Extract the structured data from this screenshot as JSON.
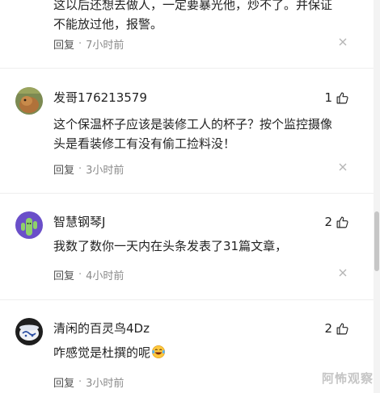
{
  "top_partial": {
    "text_line1": "这以后还想去做人，一定要暴光他，炒不了。并保证",
    "text_line2": "不能放过他，报警。",
    "reply_label": "回复",
    "separator": "·",
    "time": "7小时前"
  },
  "comments": [
    {
      "username": "发哥176213579",
      "likes": "1",
      "text_line1": "这个保温杯子应该是装修工人的杯子？按个监控摄像",
      "text_line2": "头是看装修工有没有偷工捡料没！",
      "reply_label": "回复",
      "separator": "·",
      "time": "3小时前"
    },
    {
      "username": "智慧钢琴J",
      "likes": "2",
      "text_line1": "我数了数你一天内在头条发表了31篇文章，",
      "reply_label": "回复",
      "separator": "·",
      "time": "4小时前"
    },
    {
      "username": "清闲的百灵鸟4Dz",
      "likes": "2",
      "text_line1": "咋感觉是杜撰的呢",
      "emoji": "laughing-crying-emoji",
      "reply_label": "回复",
      "separator": "·",
      "time": "3小时前"
    }
  ],
  "watermark": "阿怖观察",
  "colors": {
    "text": "#222222",
    "meta": "#8a8a8a",
    "divider": "#eeeeee"
  }
}
